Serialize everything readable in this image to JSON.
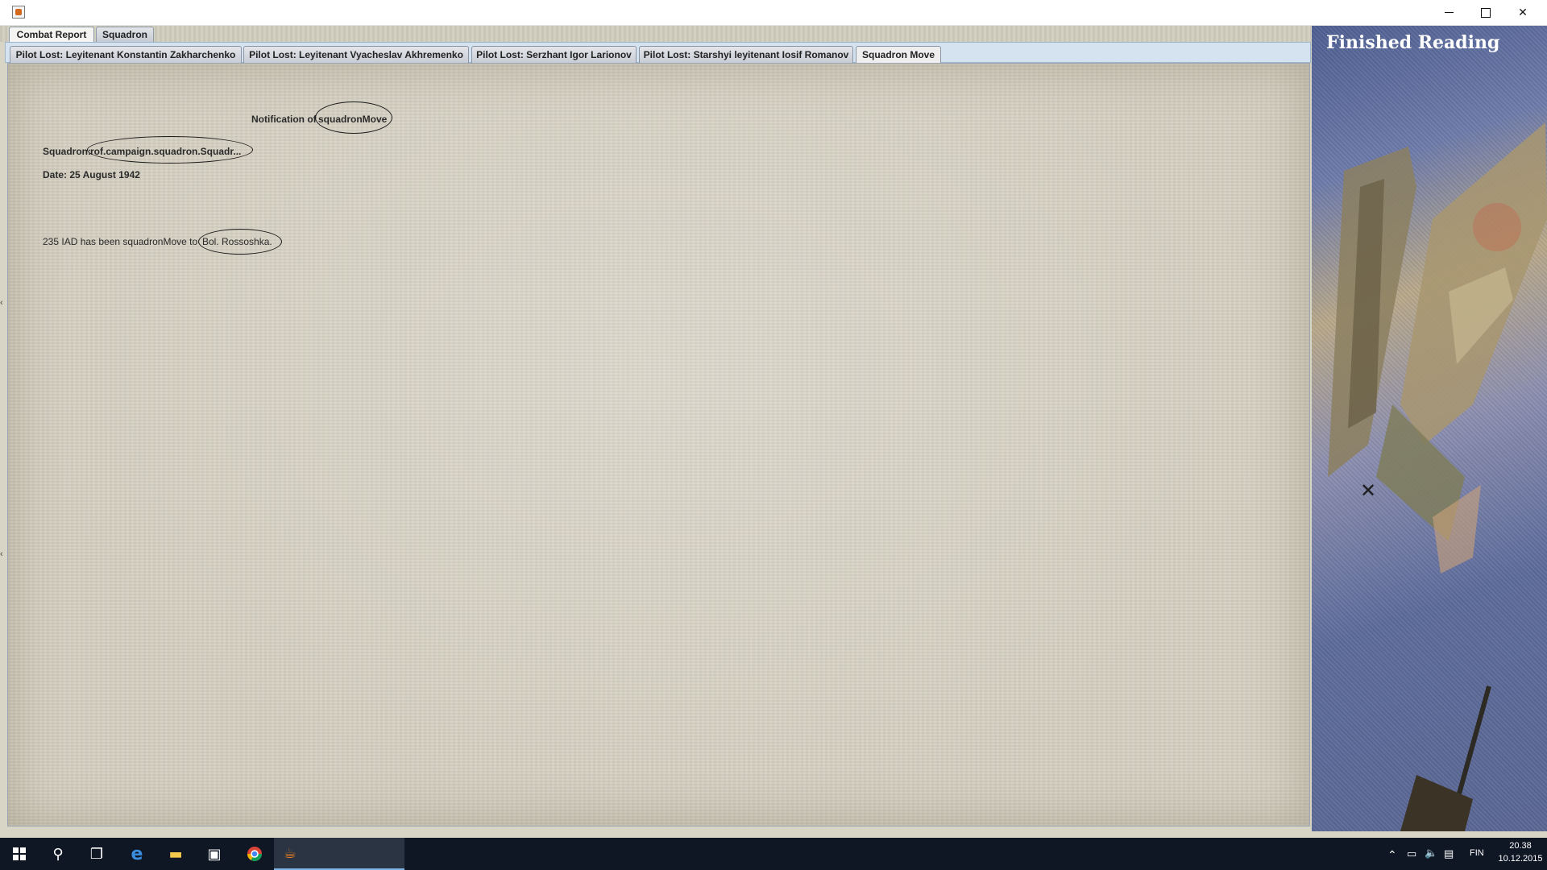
{
  "window": {
    "controls": {
      "minimize": "minimize-icon",
      "maximize": "maximize-icon",
      "close": "close-icon"
    }
  },
  "outer_tabs": [
    {
      "label": "Combat Report",
      "selected": true
    },
    {
      "label": "Squadron",
      "selected": false
    }
  ],
  "inner_tabs": [
    {
      "label": "Pilot Lost: Leyitenant Konstantin Zakharchenko"
    },
    {
      "label": "Pilot Lost: Leyitenant Vyacheslav Akhremenko"
    },
    {
      "label": "Pilot Lost: Serzhant Igor Larionov"
    },
    {
      "label": "Pilot Lost: Starshyi leyitenant Iosif Romanov"
    },
    {
      "label": "Squadron Move",
      "selected": true
    }
  ],
  "report": {
    "heading_prefix": "Notification of",
    "heading_value": "squadronMove",
    "squadron_label": "Squadron:",
    "squadron_value": "rof.campaign.squadron.Squadr...",
    "date_line": "Date: 25 August 1942",
    "body_prefix": "235 IAD has been squadronMove to",
    "body_location": "Bol. Rossoshka."
  },
  "side_panel": {
    "button_label": "Finished Reading"
  },
  "taskbar": {
    "language": "FIN",
    "time": "20.38",
    "date": "10.12.2015"
  }
}
